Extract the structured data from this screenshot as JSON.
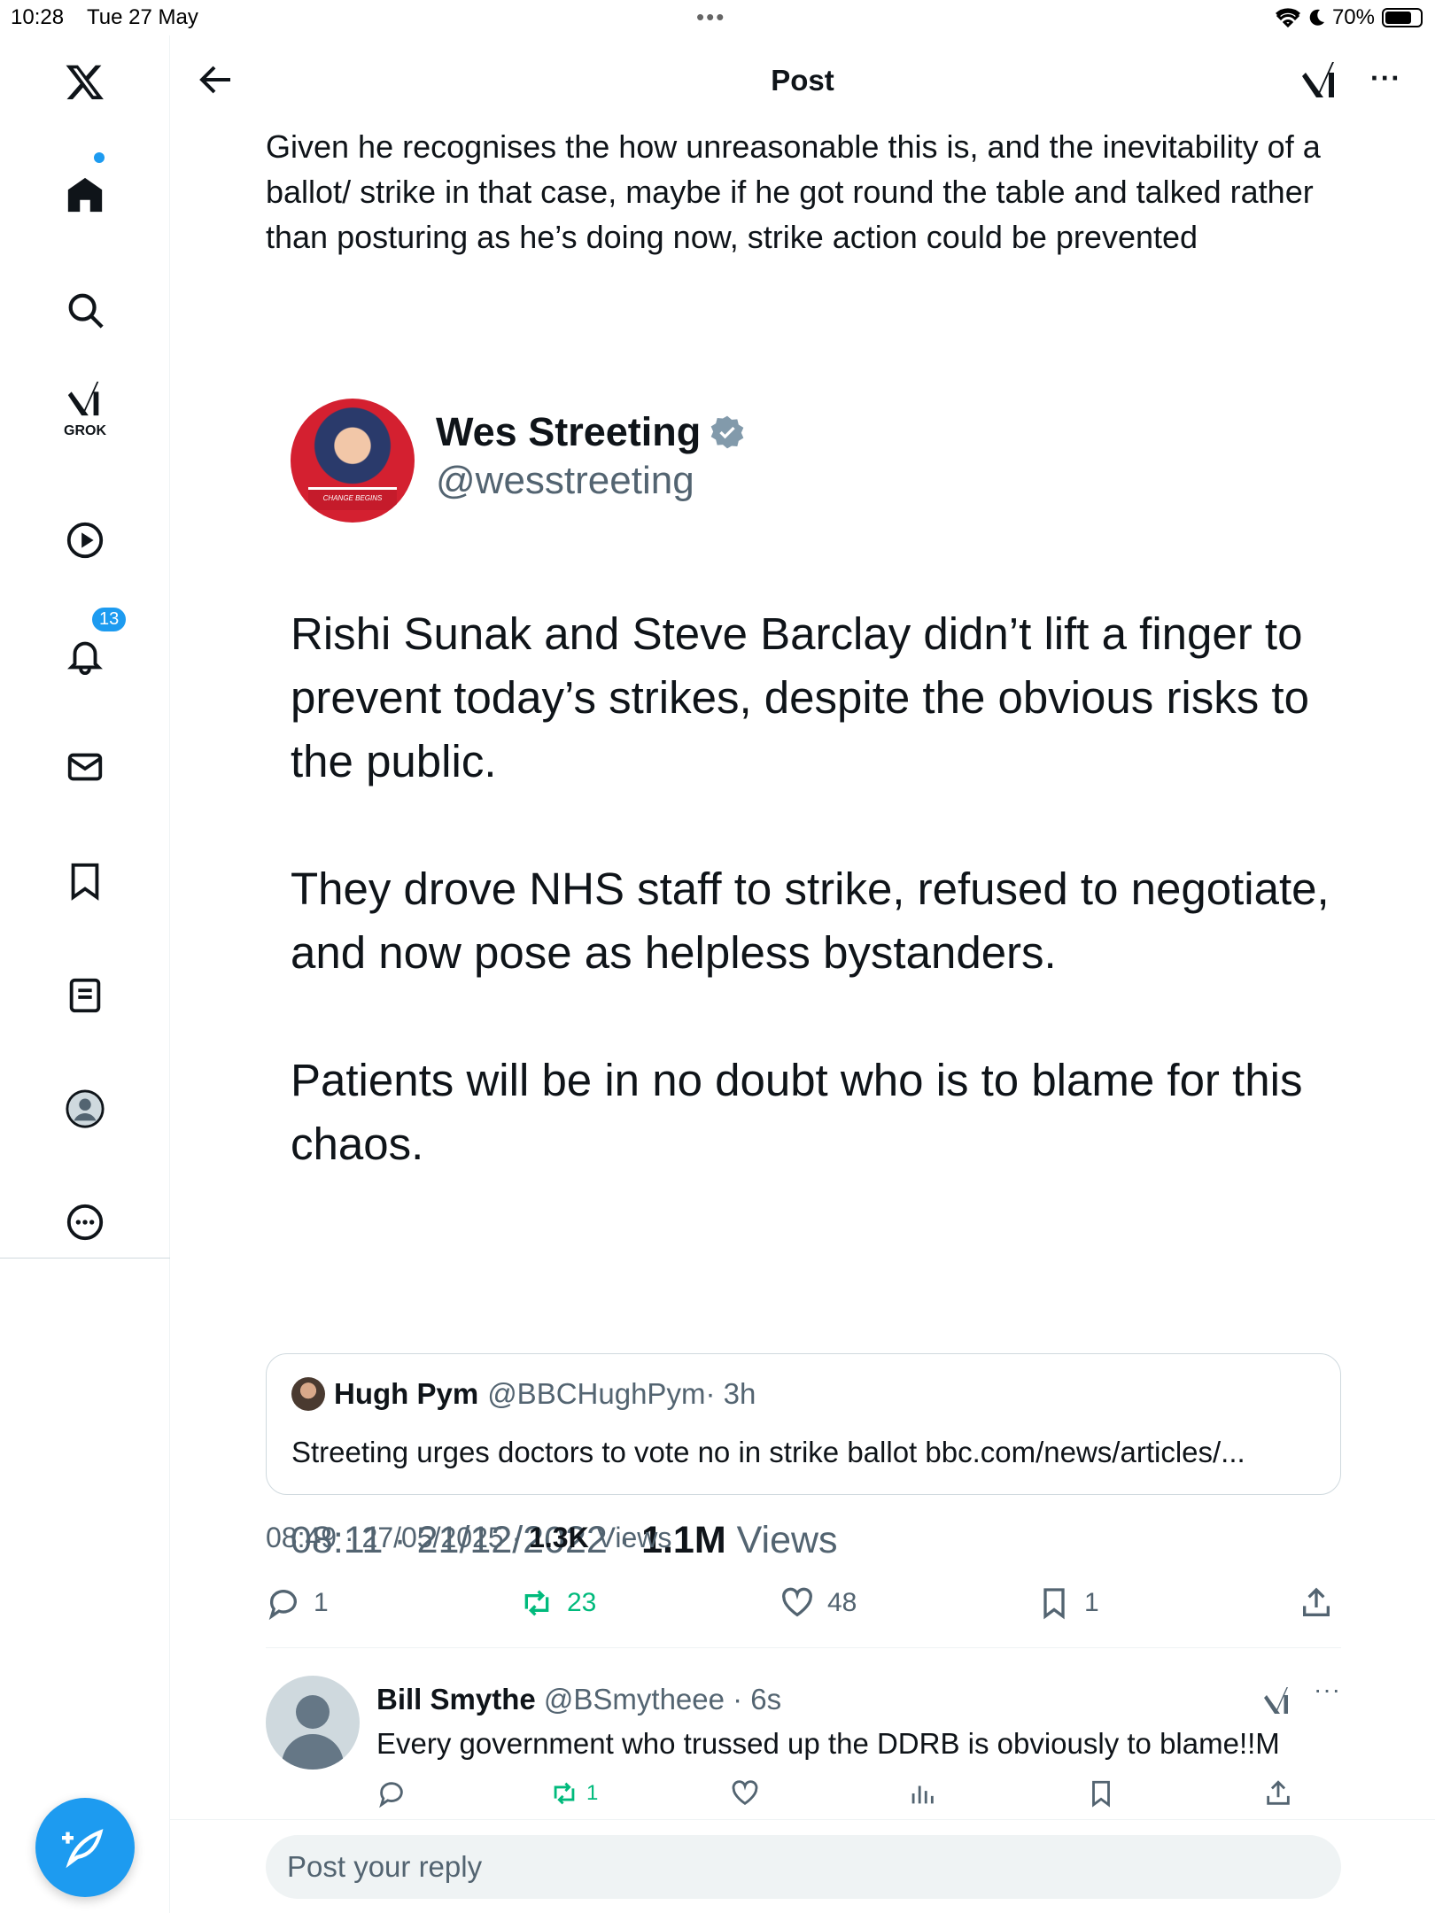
{
  "status_bar": {
    "time": "10:28",
    "date": "Tue 27 May",
    "battery": "70%"
  },
  "header": {
    "title": "Post"
  },
  "sidebar": {
    "grok_label": "GROK",
    "notifications_badge": "13"
  },
  "reply_post_text": "Given he recognises the how unreasonable this is, and the inevitability of a ballot/ strike in that case, maybe if he got round the table and talked rather than posturing as he’s doing now, strike action could be prevented",
  "embedded_tweet": {
    "name": "Wes Streeting",
    "handle": "@wesstreeting",
    "paragraphs": [
      "Rishi Sunak and Steve Barclay didn’t lift a finger to prevent today’s strikes, despite the obvious risks to the public.",
      "They drove NHS staff to strike, refused to negotiate, and now pose as helpless bystanders.",
      "Patients will be in no doubt who is to blame for this chaos."
    ],
    "time": "08:11 · 21/12/2022 · ",
    "views_count": "1.1M",
    "views_label": " Views",
    "podium_text": "CHANGE BEGINS"
  },
  "quote": {
    "name": "Hugh Pym",
    "handle": "@BBCHughPym",
    "time": " · 3h",
    "text": "Streeting urges doctors to vote no in strike ballot bbc.com/news/articles/..."
  },
  "post_meta": {
    "time": "08:49 · 27/05/2025 · ",
    "views_count": "1.3K",
    "views_label": " Views"
  },
  "actions": {
    "replies": "1",
    "reposts": "23",
    "likes": "48",
    "bookmarks": "1"
  },
  "reply": {
    "name": "Bill Smythe",
    "handle": "@BSmytheee",
    "time": " · 6s",
    "text": "Every government who trussed up the DDRB is obviously to blame!!M",
    "reposts": "1"
  },
  "composer": {
    "placeholder": "Post your reply"
  },
  "colors": {
    "accent": "#1d9bf0",
    "repost_green": "#00ba7c",
    "muted": "#536471"
  }
}
